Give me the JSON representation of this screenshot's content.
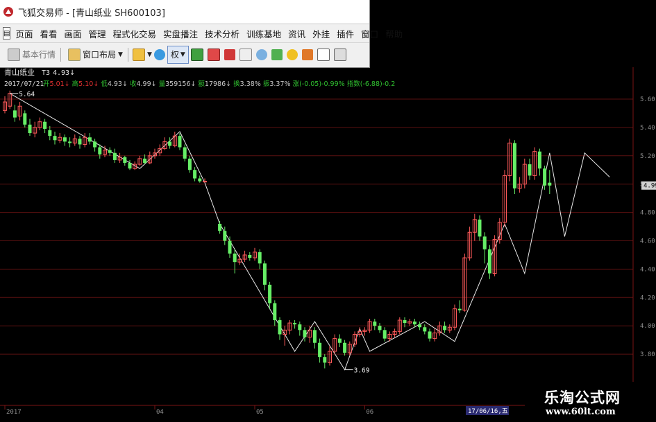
{
  "window": {
    "title": "飞狐交易师 - [青山纸业 SH600103]"
  },
  "menu": [
    "页面",
    "看看",
    "画面",
    "管理",
    "程式化交易",
    "实盘播注",
    "技术分析",
    "训练基地",
    "资讯",
    "外挂",
    "插件",
    "窗口",
    "帮助"
  ],
  "toolbar": {
    "basic_quote": "基本行情",
    "layout": "窗口布局",
    "rights": "权"
  },
  "stock": {
    "name": "青山纸业",
    "code_tag": "T3",
    "price_tag": "4.93",
    "date": "2017/07/21",
    "info_items": [
      {
        "label": "开",
        "value": "5.01",
        "arrow": "↓",
        "color": "#e03030"
      },
      {
        "label": "高",
        "value": "5.10",
        "arrow": "↓",
        "color": "#e03030"
      },
      {
        "label": "低",
        "value": "4.93",
        "arrow": "↓",
        "color": "#c8c8c8"
      },
      {
        "label": "收",
        "value": "4.99",
        "arrow": "↓",
        "color": "#c8c8c8"
      },
      {
        "label": "量",
        "value": "359156",
        "arrow": "↓",
        "color": "#c8c8c8"
      },
      {
        "label": "额",
        "value": "17986",
        "arrow": "↓",
        "color": "#c8c8c8"
      },
      {
        "label": "换",
        "value": "3.38%",
        "arrow": "",
        "color": "#c8c8c8"
      },
      {
        "label": "振",
        "value": "3.37%",
        "arrow": "",
        "color": "#c8c8c8"
      },
      {
        "label": "涨",
        "value": "(-0.05)-0.99%",
        "arrow": "",
        "color": "#30c030"
      },
      {
        "label": "指数",
        "value": "(-6.88)-0.2",
        "arrow": "",
        "color": "#30c030"
      }
    ]
  },
  "chart_data": {
    "type": "candlestick",
    "ylim": [
      3.6,
      5.6
    ],
    "y_ticks": [
      "5.60",
      "5.40",
      "5.20",
      "5.00",
      "4.80",
      "4.60",
      "4.40",
      "4.20",
      "4.00",
      "3.80"
    ],
    "current_price_label": "4.99",
    "x_labels": [
      {
        "text": "2017",
        "i": 0
      },
      {
        "text": "04",
        "i": 30
      },
      {
        "text": "05",
        "i": 50
      },
      {
        "text": "06",
        "i": 72
      }
    ],
    "cursor_date": "17/06/16,五",
    "annotations": [
      {
        "text": "5.64",
        "i": 1,
        "price": 5.64
      },
      {
        "text": "3.69",
        "i": 68,
        "price": 3.69
      }
    ],
    "zigzag": [
      [
        1,
        5.64
      ],
      [
        27,
        5.11
      ],
      [
        35,
        5.37
      ],
      [
        40,
        5.01
      ],
      [
        43,
        4.72
      ],
      [
        58,
        3.82
      ],
      [
        62,
        4.03
      ],
      [
        68,
        3.69
      ],
      [
        71,
        3.98
      ],
      [
        73,
        3.82
      ],
      [
        84,
        4.03
      ],
      [
        90,
        3.89
      ],
      [
        100,
        4.72
      ],
      [
        104,
        4.37
      ],
      [
        109,
        5.22
      ],
      [
        112,
        4.63
      ],
      [
        116,
        5.22
      ],
      [
        121,
        5.05
      ]
    ],
    "candles": [
      [
        5.52,
        5.58,
        5.62,
        5.5
      ],
      [
        5.55,
        5.64,
        5.66,
        5.53
      ],
      [
        5.52,
        5.47,
        5.56,
        5.44
      ],
      [
        5.48,
        5.55,
        5.58,
        5.45
      ],
      [
        5.5,
        5.42,
        5.52,
        5.4
      ],
      [
        5.42,
        5.36,
        5.46,
        5.34
      ],
      [
        5.36,
        5.4,
        5.44,
        5.33
      ],
      [
        5.4,
        5.44,
        5.47,
        5.38
      ],
      [
        5.44,
        5.39,
        5.46,
        5.36
      ],
      [
        5.38,
        5.34,
        5.41,
        5.31
      ],
      [
        5.34,
        5.31,
        5.37,
        5.28
      ],
      [
        5.31,
        5.33,
        5.36,
        5.29
      ],
      [
        5.33,
        5.3,
        5.35,
        5.27
      ],
      [
        5.3,
        5.29,
        5.33,
        5.26
      ],
      [
        5.29,
        5.32,
        5.35,
        5.27
      ],
      [
        5.32,
        5.28,
        5.34,
        5.25
      ],
      [
        5.28,
        5.33,
        5.36,
        5.26
      ],
      [
        5.33,
        5.3,
        5.36,
        5.28
      ],
      [
        5.3,
        5.26,
        5.32,
        5.23
      ],
      [
        5.26,
        5.21,
        5.28,
        5.18
      ],
      [
        5.21,
        5.24,
        5.27,
        5.19
      ],
      [
        5.24,
        5.22,
        5.26,
        5.2
      ],
      [
        5.22,
        5.17,
        5.25,
        5.15
      ],
      [
        5.17,
        5.19,
        5.22,
        5.15
      ],
      [
        5.19,
        5.15,
        5.2,
        5.13
      ],
      [
        5.15,
        5.11,
        5.17,
        5.1
      ],
      [
        5.11,
        5.14,
        5.16,
        5.1
      ],
      [
        5.14,
        5.18,
        5.2,
        5.13
      ],
      [
        5.18,
        5.15,
        5.21,
        5.14
      ],
      [
        5.15,
        5.2,
        5.23,
        5.14
      ],
      [
        5.2,
        5.22,
        5.25,
        5.18
      ],
      [
        5.22,
        5.25,
        5.28,
        5.2
      ],
      [
        5.25,
        5.3,
        5.33,
        5.24
      ],
      [
        5.3,
        5.27,
        5.33,
        5.25
      ],
      [
        5.27,
        5.34,
        5.37,
        5.26
      ],
      [
        5.34,
        5.26,
        5.36,
        5.24
      ],
      [
        5.26,
        5.18,
        5.28,
        5.16
      ],
      [
        5.18,
        5.1,
        5.2,
        5.08
      ],
      [
        5.1,
        5.04,
        5.12,
        5.02
      ],
      [
        5.04,
        5.02,
        5.06,
        5.01
      ],
      [
        5.02,
        5.02,
        5.04,
        5.01
      ],
      null,
      null,
      [
        4.72,
        4.67,
        4.74,
        4.65
      ],
      [
        4.67,
        4.6,
        4.7,
        4.57
      ],
      [
        4.6,
        4.51,
        4.63,
        4.48
      ],
      [
        4.51,
        4.45,
        4.54,
        4.37
      ],
      [
        4.45,
        4.47,
        4.51,
        4.43
      ],
      [
        4.47,
        4.5,
        4.53,
        4.45
      ],
      [
        4.5,
        4.48,
        4.52,
        4.46
      ],
      [
        4.48,
        4.52,
        4.55,
        4.46
      ],
      [
        4.52,
        4.44,
        4.54,
        4.4
      ],
      [
        4.44,
        4.29,
        4.46,
        4.25
      ],
      [
        4.29,
        4.16,
        4.31,
        4.12
      ],
      [
        4.16,
        4.04,
        4.18,
        4.0
      ],
      [
        4.04,
        3.94,
        4.06,
        3.9
      ],
      [
        3.94,
        3.97,
        4.0,
        3.86
      ],
      [
        3.97,
        4.02,
        4.04,
        3.94
      ],
      [
        4.02,
        4.01,
        4.04,
        3.98
      ],
      [
        4.01,
        3.97,
        4.03,
        3.93
      ],
      [
        3.97,
        3.92,
        3.99,
        3.89
      ],
      [
        3.92,
        3.97,
        4.0,
        3.88
      ],
      [
        3.97,
        3.88,
        3.99,
        3.84
      ],
      [
        3.88,
        3.78,
        3.91,
        3.74
      ],
      [
        3.78,
        3.74,
        3.8,
        3.7
      ],
      [
        3.74,
        3.82,
        3.86,
        3.72
      ],
      [
        3.82,
        3.91,
        3.94,
        3.8
      ],
      [
        3.91,
        3.88,
        3.94,
        3.85
      ],
      [
        3.88,
        3.81,
        3.9,
        3.79
      ],
      [
        3.81,
        3.87,
        3.89,
        3.79
      ],
      [
        3.87,
        3.94,
        3.96,
        3.85
      ],
      [
        3.94,
        3.96,
        3.99,
        3.92
      ],
      [
        3.96,
        3.97,
        3.99,
        3.93
      ],
      [
        3.97,
        4.03,
        4.05,
        3.95
      ],
      [
        4.03,
        4.0,
        4.05,
        3.97
      ],
      [
        4.0,
        3.97,
        4.02,
        3.95
      ],
      [
        3.97,
        3.91,
        3.99,
        3.89
      ],
      [
        3.91,
        3.94,
        3.96,
        3.89
      ],
      [
        3.94,
        3.96,
        3.98,
        3.92
      ],
      [
        3.96,
        4.04,
        4.06,
        3.94
      ],
      [
        4.04,
        4.02,
        4.06,
        3.99
      ],
      [
        4.02,
        4.03,
        4.05,
        4.0
      ],
      [
        4.03,
        4.01,
        4.05,
        3.99
      ],
      [
        4.01,
        3.99,
        4.03,
        3.97
      ],
      [
        3.99,
        3.96,
        4.01,
        3.94
      ],
      [
        3.96,
        3.91,
        3.98,
        3.89
      ],
      [
        3.91,
        3.95,
        3.98,
        3.89
      ],
      [
        3.95,
        4.0,
        4.03,
        3.93
      ],
      [
        4.0,
        3.97,
        4.03,
        3.95
      ],
      [
        3.97,
        3.99,
        4.01,
        3.95
      ],
      [
        3.99,
        4.12,
        4.15,
        3.97
      ],
      [
        4.12,
        4.11,
        4.18,
        4.09
      ],
      [
        4.11,
        4.48,
        4.51,
        4.1
      ],
      [
        4.48,
        4.66,
        4.7,
        4.46
      ],
      [
        4.66,
        4.75,
        4.79,
        4.6
      ],
      [
        4.75,
        4.63,
        4.78,
        4.6
      ],
      [
        4.63,
        4.54,
        4.66,
        4.44
      ],
      [
        4.54,
        4.37,
        4.57,
        4.33
      ],
      [
        4.37,
        4.61,
        4.64,
        4.35
      ],
      [
        4.61,
        4.73,
        4.76,
        4.58
      ],
      [
        4.73,
        5.06,
        5.1,
        4.7
      ],
      [
        5.06,
        5.29,
        5.32,
        5.02
      ],
      [
        5.29,
        4.97,
        5.31,
        4.93
      ],
      [
        4.97,
        5.0,
        5.05,
        4.94
      ],
      [
        5.0,
        5.14,
        5.18,
        4.97
      ],
      [
        5.14,
        5.06,
        5.18,
        5.03
      ],
      [
        5.06,
        5.23,
        5.26,
        5.03
      ],
      [
        5.23,
        5.11,
        5.25,
        5.06
      ],
      [
        5.11,
        4.99,
        5.13,
        4.96
      ],
      [
        5.01,
        4.99,
        5.1,
        4.93
      ]
    ]
  },
  "watermark": {
    "line1": "乐淘公式网",
    "line2": "www.60lt.com"
  }
}
